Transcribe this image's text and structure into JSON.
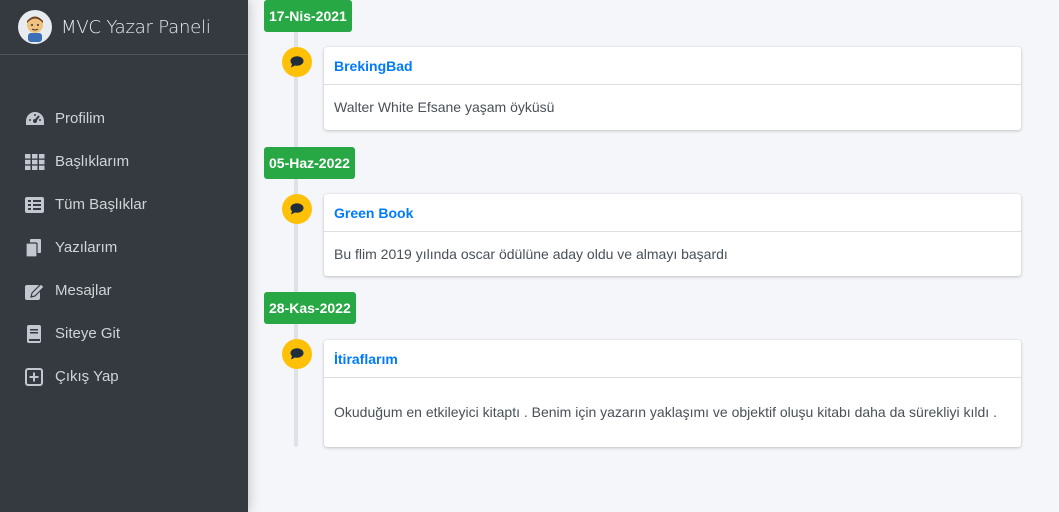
{
  "brand": {
    "title": "MVC Yazar Paneli"
  },
  "sidebar": {
    "items": [
      {
        "label": "Profilim",
        "icon": "tachometer-icon"
      },
      {
        "label": "Başlıklarım",
        "icon": "grid-icon"
      },
      {
        "label": "Tüm Başlıklar",
        "icon": "list-icon"
      },
      {
        "label": "Yazılarım",
        "icon": "copy-icon"
      },
      {
        "label": "Mesajlar",
        "icon": "edit-icon"
      },
      {
        "label": "Siteye Git",
        "icon": "book-icon"
      },
      {
        "label": "Çıkış Yap",
        "icon": "plus-square-icon"
      }
    ]
  },
  "timeline": [
    {
      "date": "17-Nis-2021",
      "title": "BrekingBad",
      "body": "Walter White Efsane yaşam öyküsü"
    },
    {
      "date": "05-Haz-2022",
      "title": "Green Book",
      "body": "Bu flim 2019 yılında oscar ödülüne aday oldu ve almayı başardı"
    },
    {
      "date": "28-Kas-2022",
      "title": "İtiraflarım",
      "body": "Okuduğum en etkileyici kitaptı . Benim için yazarın yaklaşımı ve objektif oluşu kitabı daha da sürekliyi kıldı ."
    }
  ],
  "colors": {
    "sidebar": "#343a40",
    "label": "#28a745",
    "icon": "#ffc107",
    "link": "#007bff",
    "background": "#f4f6f9"
  }
}
